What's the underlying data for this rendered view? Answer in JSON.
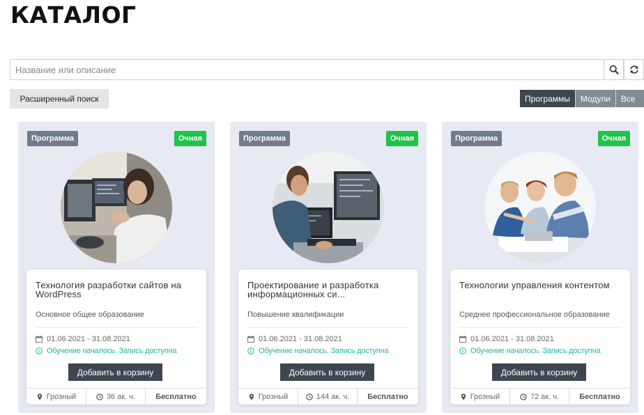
{
  "page": {
    "title": "КАТАЛОГ"
  },
  "search": {
    "placeholder": "Название или описание",
    "search_icon": "search-icon",
    "reset_icon": "refresh-icon"
  },
  "advanced_search": {
    "label": "Расширенный поиск"
  },
  "filters": [
    {
      "label": "Программы",
      "active": true
    },
    {
      "label": "Модули",
      "active": false
    },
    {
      "label": "Все",
      "active": false
    }
  ],
  "cards": [
    {
      "type": "Программа",
      "form": "Очная",
      "title": "Технология разработки сайтов на WordPress",
      "level": "Основное общее образование",
      "dates": "01.06.2021 - 31.08.2021",
      "status": "Обучение началось. Запись доступна",
      "button": "Добавить в корзину",
      "location": "Грозный",
      "hours": "36 ак. ч.",
      "price": "Бесплатно"
    },
    {
      "type": "Программа",
      "form": "Очная",
      "title": "Проектирование и разработка информационных си...",
      "level": "Повышение квалификации",
      "dates": "01.06.2021 - 31.08.2021",
      "status": "Обучение началось. Запись доступна",
      "button": "Добавить в корзину",
      "location": "Грозный",
      "hours": "144 ак. ч.",
      "price": "Бесплатно"
    },
    {
      "type": "Программа",
      "form": "Очная",
      "title": "Технологии управления контентом",
      "level": "Среднее профессиональное образование",
      "dates": "01.06.2021 - 31.08.2021",
      "status": "Обучение началось. Запись доступна",
      "button": "Добавить в корзину",
      "location": "Грозный",
      "hours": "72 ак. ч.",
      "price": "Бесплатно"
    }
  ],
  "colors": {
    "type_badge": "#707c88",
    "form_badge": "#1ec44a",
    "status_text": "#1bb6a6",
    "button_dark": "#3e4651",
    "card_bg": "#e7e9f3"
  }
}
